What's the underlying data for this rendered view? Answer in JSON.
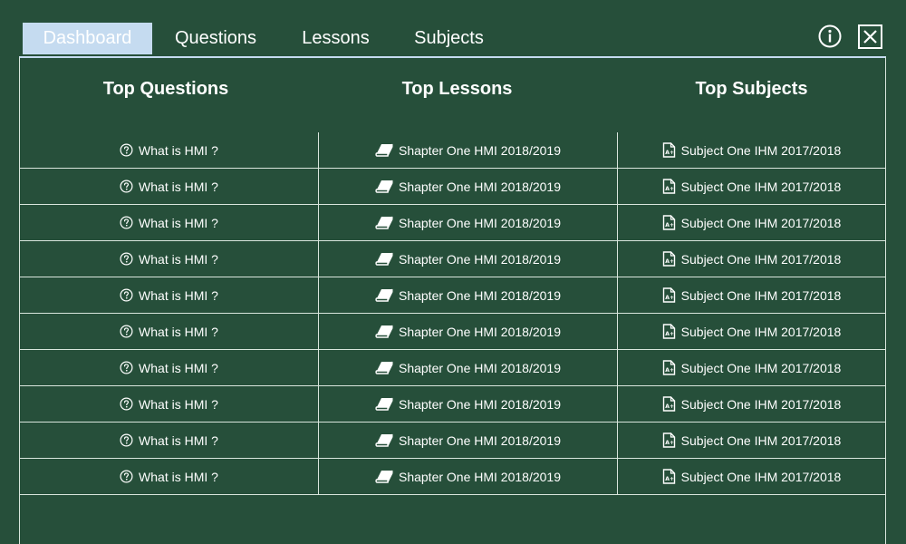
{
  "tabs": [
    {
      "label": "Dashboard",
      "active": true
    },
    {
      "label": "Questions",
      "active": false
    },
    {
      "label": "Lessons",
      "active": false
    },
    {
      "label": "Subjects",
      "active": false
    }
  ],
  "header_icons": [
    "info-icon",
    "close-icon"
  ],
  "colors": {
    "background": "#264f3a",
    "active_tab": "#c5dbf0",
    "text": "#ffffff",
    "border": "#d9e6dd"
  },
  "columns": {
    "questions": "Top Questions",
    "lessons": "Top Lessons",
    "subjects": "Top Subjects"
  },
  "rows": [
    {
      "question": "What is HMI ?",
      "lesson": "Shapter One HMI 2018/2019",
      "subject": "Subject One IHM 2017/2018"
    },
    {
      "question": "What is HMI ?",
      "lesson": "Shapter One HMI 2018/2019",
      "subject": "Subject One IHM 2017/2018"
    },
    {
      "question": "What is HMI ?",
      "lesson": "Shapter One HMI 2018/2019",
      "subject": "Subject One IHM 2017/2018"
    },
    {
      "question": "What is HMI ?",
      "lesson": "Shapter One HMI 2018/2019",
      "subject": "Subject One IHM 2017/2018"
    },
    {
      "question": "What is HMI ?",
      "lesson": "Shapter One HMI 2018/2019",
      "subject": "Subject One IHM 2017/2018"
    },
    {
      "question": "What is HMI ?",
      "lesson": "Shapter One HMI 2018/2019",
      "subject": "Subject One IHM 2017/2018"
    },
    {
      "question": "What is HMI ?",
      "lesson": "Shapter One HMI 2018/2019",
      "subject": "Subject One IHM 2017/2018"
    },
    {
      "question": "What is HMI ?",
      "lesson": "Shapter One HMI 2018/2019",
      "subject": "Subject One IHM 2017/2018"
    },
    {
      "question": "What is HMI ?",
      "lesson": "Shapter One HMI 2018/2019",
      "subject": "Subject One IHM 2017/2018"
    },
    {
      "question": "What is HMI ?",
      "lesson": "Shapter One HMI 2018/2019",
      "subject": "Subject One IHM 2017/2018"
    }
  ]
}
